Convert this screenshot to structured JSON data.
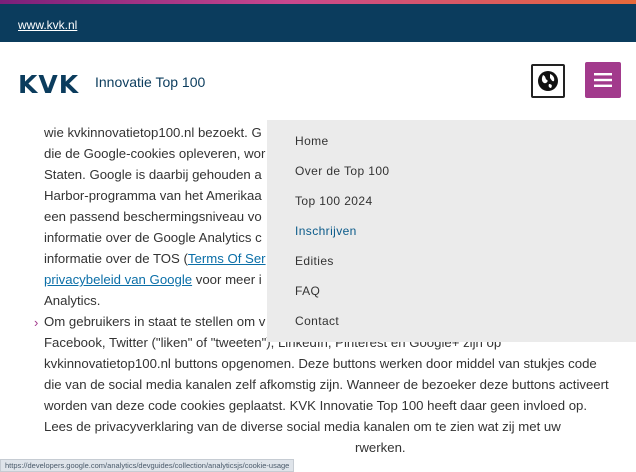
{
  "topbar": {
    "site_link": "www.kvk.nl"
  },
  "header": {
    "logo": "KVK",
    "subtitle": "Innovatie Top 100",
    "globe_icon": "globe-icon",
    "menu_icon": "hamburger-icon"
  },
  "content": {
    "lines": [
      "wie kvkinnovatietop100.nl bezoekt. G",
      "die de Google-cookies opleveren, wor",
      "Staten. Google is daarbij gehouden a",
      "Harbor-programma van het Amerikaa",
      "een passend beschermingsniveau vo",
      "informatie over de Google Analytics c",
      "informatie over de TOS ("
    ],
    "tos_link": "Terms Of Ser",
    "privacy_link": "privacybeleid van Google",
    "privacy_rest": " voor meer i",
    "analytics_line": "Analytics.",
    "bullet_line": "Om gebruikers in staat te stellen om v",
    "para_lines": [
      "Facebook, Twitter (\"liken\" of \"tweeten\"), LinkedIn, Pinterest en Google+ zijn op",
      "kvkinnovatietop100.nl buttons opgenomen. Deze buttons werken door middel van stukjes code",
      "die van de social media kanalen zelf afkomstig zijn. Wanneer de bezoeker deze buttons activeert",
      "worden van deze code cookies geplaatst. KVK Innovatie Top 100 heeft daar geen invloed op.",
      "Lees de privacyverklaring van de diverse social media kanalen om te zien wat zij met uw"
    ],
    "last_fragment": "rwerken."
  },
  "menu": {
    "items": [
      "Home",
      "Over de Top 100",
      "Top 100 2024",
      "Inschrijven",
      "Edities",
      "FAQ",
      "Contact"
    ],
    "active_index": 3
  },
  "statusbar": {
    "url": "https://developers.google.com/analytics/devguides/collection/analyticsjs/cookie-usage"
  },
  "colors": {
    "topbar": "#0b3c5d",
    "menu_button": "#a23a8c",
    "link": "#0b6fa8",
    "active_menu": "#0b5b8a"
  }
}
